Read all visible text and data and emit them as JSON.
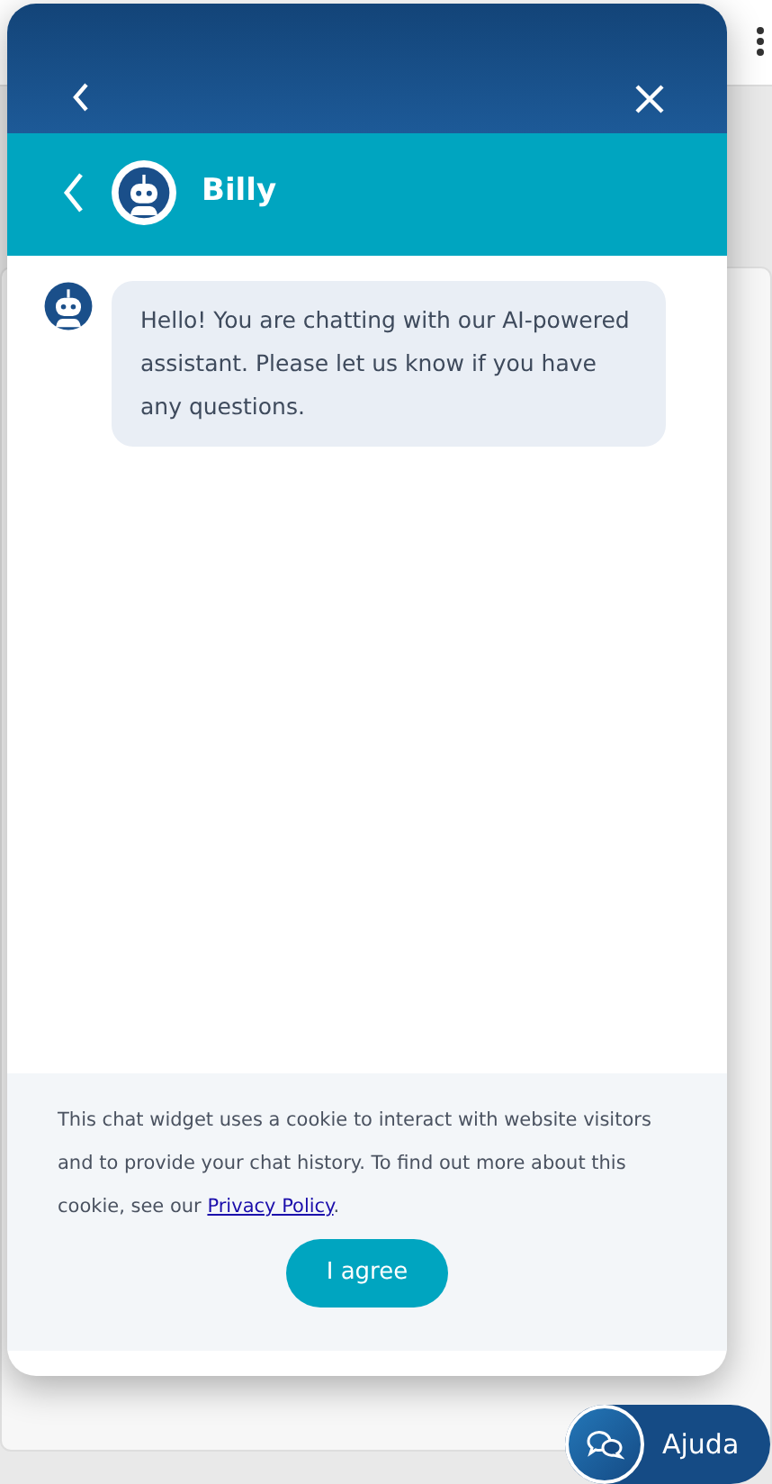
{
  "chat": {
    "agent_name": "Billy",
    "messages": [
      {
        "text": "Hello! You are chatting with our AI-powered assistant. Please let us know if you have any questions."
      }
    ],
    "cookie_notice": {
      "text": "This chat widget uses a cookie to interact with website visitors and to provide your chat history. To find out more about this cookie, see our ",
      "link": "Privacy Policy",
      "after": ".",
      "button": "I agree"
    }
  },
  "launcher": {
    "label": "Ajuda"
  }
}
